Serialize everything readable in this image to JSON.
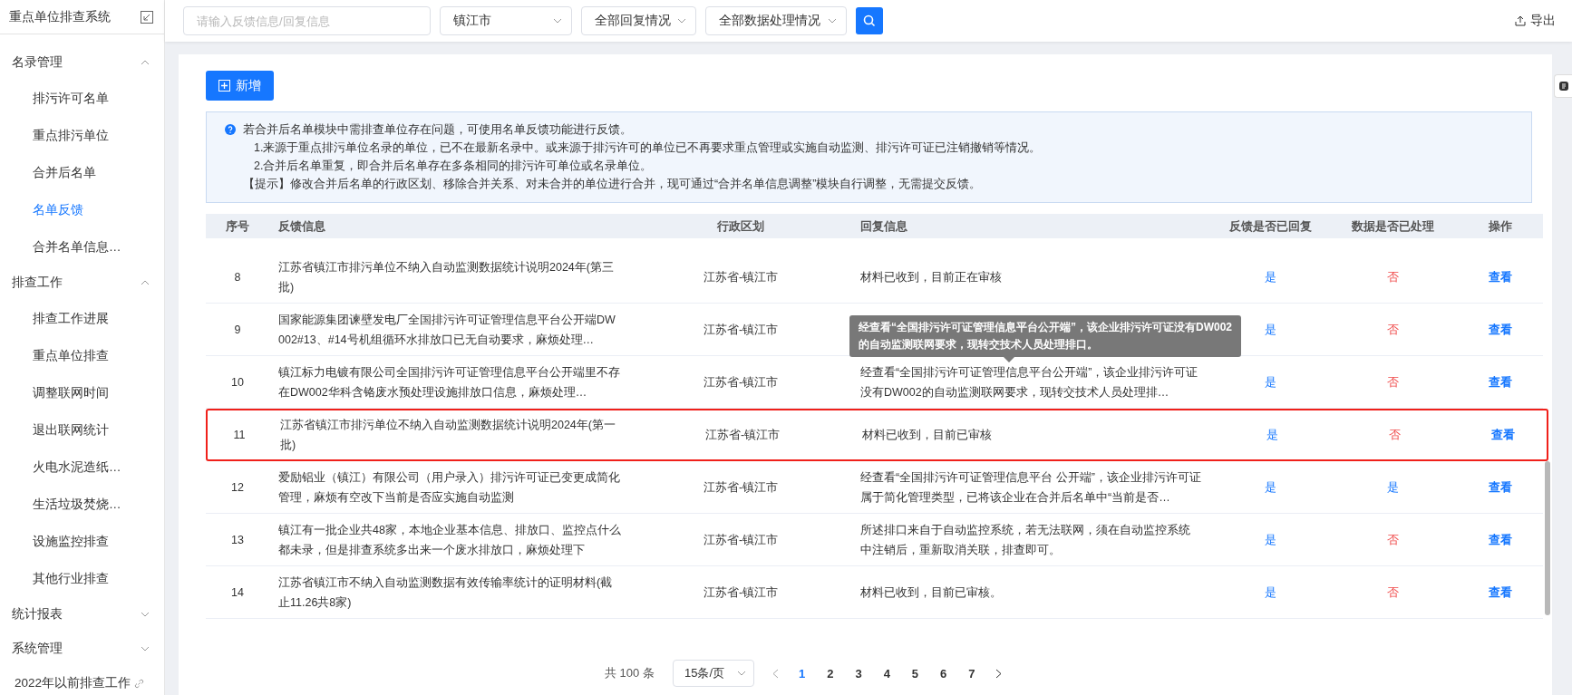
{
  "sidebar": {
    "title": "重点单位排查系统",
    "groups": [
      {
        "label": "名录管理",
        "expanded": true,
        "items": [
          {
            "label": "排污许可名单",
            "selected": false
          },
          {
            "label": "重点排污单位",
            "selected": false
          },
          {
            "label": "合并后名单",
            "selected": false
          },
          {
            "label": "名单反馈",
            "selected": true
          },
          {
            "label": "合并名单信息…",
            "selected": false
          }
        ]
      },
      {
        "label": "排查工作",
        "expanded": true,
        "items": [
          {
            "label": "排查工作进展",
            "selected": false
          },
          {
            "label": "重点单位排查",
            "selected": false
          },
          {
            "label": "调整联网时间",
            "selected": false
          },
          {
            "label": "退出联网统计",
            "selected": false
          },
          {
            "label": "火电水泥造纸…",
            "selected": false
          },
          {
            "label": "生活垃圾焚烧…",
            "selected": false
          },
          {
            "label": "设施监控排查",
            "selected": false
          },
          {
            "label": "其他行业排查",
            "selected": false
          }
        ]
      },
      {
        "label": "统计报表",
        "expanded": false
      },
      {
        "label": "系统管理",
        "expanded": false
      }
    ],
    "link": "2022年以前排查工作"
  },
  "toolbar": {
    "search": {
      "placeholder": "请输入反馈信息/回复信息"
    },
    "filters": [
      "镇江市",
      "全部回复情况",
      "全部数据处理情况"
    ],
    "export": "导出"
  },
  "add_button": "新增",
  "notice": {
    "lines": [
      "若合并后名单模块中需排查单位存在问题，可使用名单反馈功能进行反馈。",
      "1.来源于重点排污单位名录的单位，已不在最新名录中。或来源于排污许可的单位已不再要求重点管理或实施自动监测、排污许可证已注销撤销等情况。",
      "2.合并后名单重复，即合并后名单存在多条相同的排污许可单位或名录单位。",
      "【提示】修改合并后名单的行政区划、移除合并关系、对未合并的单位进行合并，现可通过“合并名单信息调整”模块自行调整，无需提交反馈。"
    ]
  },
  "table": {
    "columns": [
      "序号",
      "反馈信息",
      "行政区划",
      "回复信息",
      "反馈是否已回复",
      "数据是否已处理",
      "操作"
    ],
    "rows": [
      {
        "index": "8",
        "feedback": "江苏省镇江市排污单位不纳入自动监测数据统计说明2024年(第三批)",
        "region": "江苏省-镇江市",
        "reply": "材料已收到，目前正在审核",
        "replied": {
          "text": "是",
          "yes": true
        },
        "processed": {
          "text": "否",
          "yes": false
        },
        "action": "查看",
        "highlighted": false
      },
      {
        "index": "9",
        "feedback": "国家能源集团谏壁发电厂全国排污许可证管理信息平台公开端DW002#13、#14号机组循环水排放口已无自动要求，麻烦处理…",
        "region": "江苏省-镇江市",
        "replied": {
          "text": "是",
          "yes": true
        },
        "processed": {
          "text": "否",
          "yes": false
        },
        "action": "查看",
        "highlighted": false
      },
      {
        "index": "10",
        "feedback": "镇江标力电镀有限公司全国排污许可证管理信息平台公开端里不存在DW002华科含铬废水预处理设施排放口信息，麻烦处理…",
        "region": "江苏省-镇江市",
        "reply": "经查看“全国排污许可证管理信息平台公开端”，该企业排污许可证没有DW002的自动监测联网要求，现转交技术人员处理排…",
        "tooltip": "经查看“全国排污许可证管理信息平台公开端”，该企业排污许可证没有DW002的自动监测联网要求，现转交技术人员处理排口。",
        "replied": {
          "text": "是",
          "yes": true
        },
        "processed": {
          "text": "否",
          "yes": false
        },
        "action": "查看",
        "highlighted": false
      },
      {
        "index": "11",
        "feedback": "江苏省镇江市排污单位不纳入自动监测数据统计说明2024年(第一批)",
        "region": "江苏省-镇江市",
        "reply": "材料已收到，目前已审核",
        "replied": {
          "text": "是",
          "yes": true
        },
        "processed": {
          "text": "否",
          "yes": false
        },
        "action": "查看",
        "highlighted": true
      },
      {
        "index": "12",
        "feedback": "爱励铝业（镇江）有限公司（用户录入）排污许可证已变更成简化管理，麻烦有空改下当前是否应实施自动监测",
        "region": "江苏省-镇江市",
        "reply": "经查看“全国排污许可证管理信息平台 公开端”，该企业排污许可证属于简化管理类型，已将该企业在合并后名单中“当前是否…",
        "replied": {
          "text": "是",
          "yes": true
        },
        "processed": {
          "text": "是",
          "yes": true
        },
        "action": "查看",
        "highlighted": false
      },
      {
        "index": "13",
        "feedback": "镇江有一批企业共48家，本地企业基本信息、排放口、监控点什么都未录，但是排查系统多出来一个废水排放口，麻烦处理下",
        "region": "江苏省-镇江市",
        "reply": "所述排口来自于自动监控系统，若无法联网，须在自动监控系统中注销后，重新取消关联，排查即可。",
        "replied": {
          "text": "是",
          "yes": true
        },
        "processed": {
          "text": "否",
          "yes": false
        },
        "action": "查看",
        "highlighted": false
      },
      {
        "index": "14",
        "feedback": "江苏省镇江市不纳入自动监测数据有效传输率统计的证明材料(截止11.26共8家)",
        "region": "江苏省-镇江市",
        "reply": "材料已收到，目前已审核。",
        "replied": {
          "text": "是",
          "yes": true
        },
        "processed": {
          "text": "否",
          "yes": false
        },
        "action": "查看",
        "highlighted": false
      }
    ]
  },
  "pagination": {
    "total": "共 100 条",
    "page_size": "15条/页",
    "pages": [
      {
        "label": "1",
        "selected": true
      },
      {
        "label": "2",
        "selected": false
      },
      {
        "label": "3",
        "selected": false
      },
      {
        "label": "4",
        "selected": false
      },
      {
        "label": "5",
        "selected": false
      },
      {
        "label": "6",
        "selected": false
      },
      {
        "label": "7",
        "selected": false
      }
    ]
  }
}
